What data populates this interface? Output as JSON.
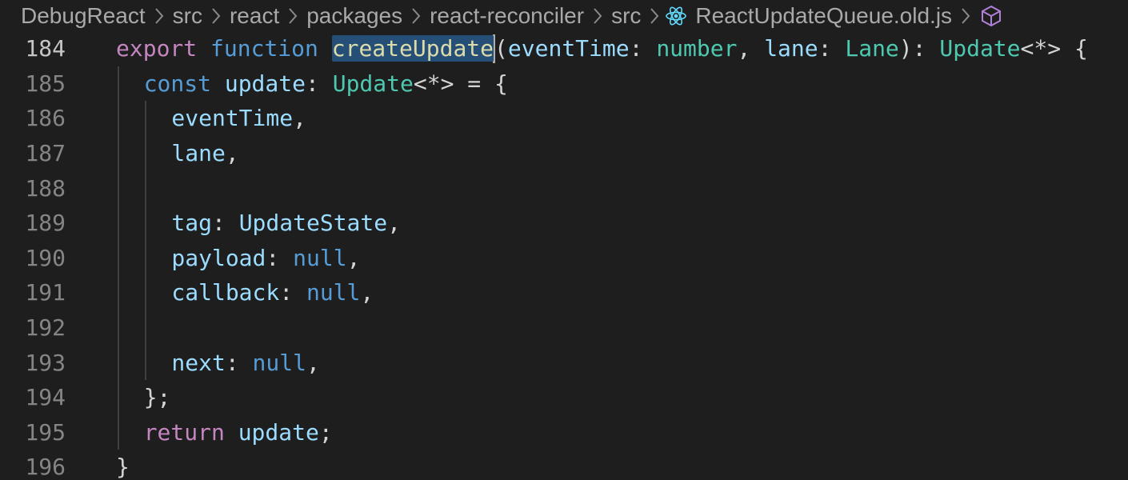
{
  "breadcrumb": {
    "items": [
      "DebugReact",
      "src",
      "react",
      "packages",
      "react-reconciler",
      "src"
    ],
    "file": "ReactUpdateQueue.old.js",
    "file_icon": "react-icon",
    "trailing_icon": "symbol-box-icon"
  },
  "editor": {
    "active_line": "184",
    "selected_word": "createUpdate",
    "lines": [
      {
        "n": "184",
        "indent": 0,
        "tokens": [
          {
            "t": "export",
            "c": "kw"
          },
          {
            "t": " ",
            "c": "punc"
          },
          {
            "t": "function",
            "c": "sto"
          },
          {
            "t": " ",
            "c": "punc"
          },
          {
            "t": "createUpdate",
            "c": "fn sel"
          },
          {
            "t": "",
            "c": "cursor"
          },
          {
            "t": "(",
            "c": "punc"
          },
          {
            "t": "eventTime",
            "c": "var"
          },
          {
            "t": ": ",
            "c": "punc"
          },
          {
            "t": "number",
            "c": "type"
          },
          {
            "t": ", ",
            "c": "punc"
          },
          {
            "t": "lane",
            "c": "var"
          },
          {
            "t": ": ",
            "c": "punc"
          },
          {
            "t": "Lane",
            "c": "type"
          },
          {
            "t": "): ",
            "c": "punc"
          },
          {
            "t": "Update",
            "c": "type"
          },
          {
            "t": "<*> {",
            "c": "punc"
          }
        ]
      },
      {
        "n": "185",
        "indent": 1,
        "tokens": [
          {
            "t": "const",
            "c": "sto"
          },
          {
            "t": " ",
            "c": "punc"
          },
          {
            "t": "update",
            "c": "var"
          },
          {
            "t": ": ",
            "c": "punc"
          },
          {
            "t": "Update",
            "c": "type"
          },
          {
            "t": "<*> = {",
            "c": "punc"
          }
        ]
      },
      {
        "n": "186",
        "indent": 2,
        "tokens": [
          {
            "t": "eventTime",
            "c": "var"
          },
          {
            "t": ",",
            "c": "punc"
          }
        ]
      },
      {
        "n": "187",
        "indent": 2,
        "tokens": [
          {
            "t": "lane",
            "c": "var"
          },
          {
            "t": ",",
            "c": "punc"
          }
        ]
      },
      {
        "n": "188",
        "indent": 2,
        "tokens": []
      },
      {
        "n": "189",
        "indent": 2,
        "tokens": [
          {
            "t": "tag",
            "c": "var"
          },
          {
            "t": ": ",
            "c": "punc"
          },
          {
            "t": "UpdateState",
            "c": "var"
          },
          {
            "t": ",",
            "c": "punc"
          }
        ]
      },
      {
        "n": "190",
        "indent": 2,
        "tokens": [
          {
            "t": "payload",
            "c": "var"
          },
          {
            "t": ": ",
            "c": "punc"
          },
          {
            "t": "null",
            "c": "sto"
          },
          {
            "t": ",",
            "c": "punc"
          }
        ]
      },
      {
        "n": "191",
        "indent": 2,
        "tokens": [
          {
            "t": "callback",
            "c": "var"
          },
          {
            "t": ": ",
            "c": "punc"
          },
          {
            "t": "null",
            "c": "sto"
          },
          {
            "t": ",",
            "c": "punc"
          }
        ]
      },
      {
        "n": "192",
        "indent": 2,
        "tokens": []
      },
      {
        "n": "193",
        "indent": 2,
        "tokens": [
          {
            "t": "next",
            "c": "var"
          },
          {
            "t": ": ",
            "c": "punc"
          },
          {
            "t": "null",
            "c": "sto"
          },
          {
            "t": ",",
            "c": "punc"
          }
        ]
      },
      {
        "n": "194",
        "indent": 1,
        "tokens": [
          {
            "t": "};",
            "c": "punc"
          }
        ]
      },
      {
        "n": "195",
        "indent": 1,
        "tokens": [
          {
            "t": "return",
            "c": "kw"
          },
          {
            "t": " ",
            "c": "punc"
          },
          {
            "t": "update",
            "c": "var"
          },
          {
            "t": ";",
            "c": "punc"
          }
        ]
      },
      {
        "n": "196",
        "indent": 0,
        "tokens": [
          {
            "t": "}",
            "c": "punc"
          }
        ]
      }
    ]
  }
}
